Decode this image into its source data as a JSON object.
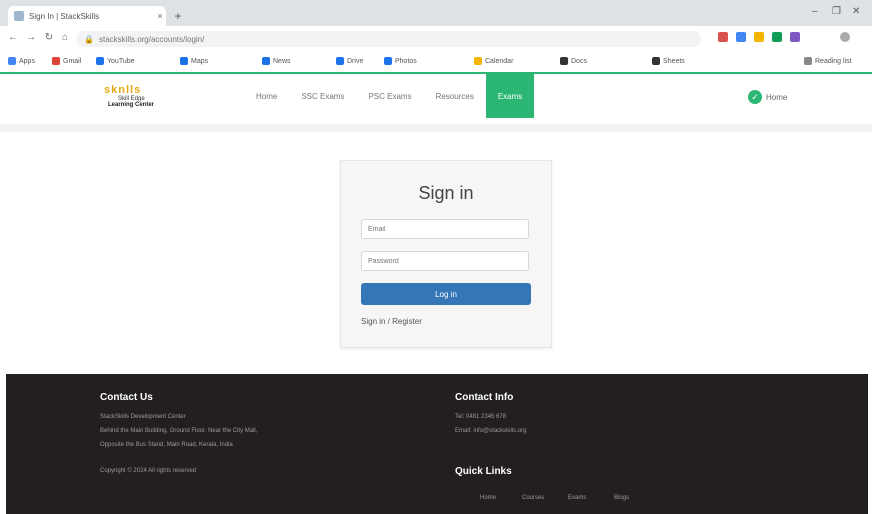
{
  "browser": {
    "tab_title": "Sign In | StackSkills",
    "tab_close": "×",
    "new_tab": "+",
    "url": "stackskills.org/accounts/login/",
    "bookmarks": [
      "Apps",
      "Gmail",
      "YouTube",
      "Maps",
      "News",
      "Drive",
      "Photos",
      "Calendar",
      "Docs",
      "Sheets"
    ],
    "other_bookmarks": "Reading list"
  },
  "site": {
    "logo_line1": "sknlls",
    "logo_line2": "Skill Edge",
    "logo_line3": "Learning Center",
    "nav": [
      "Home",
      "SSC Exams",
      "PSC Exams",
      "Resources",
      "Exams"
    ],
    "active_nav_index": 4,
    "user_initial": "✓",
    "user_label": "Home"
  },
  "signin": {
    "title": "Sign in",
    "email_placeholder": "Email",
    "password_placeholder": "Password",
    "login_label": "Log in",
    "signup_link": "Sign in / Register"
  },
  "footer": {
    "contact_us_title": "Contact Us",
    "contact_us_lines": [
      "StackSkills Development Center",
      "Behind the Main Building, Ground Floor, Near the City Mall,",
      "Opposite the Bus Stand, Main Road, Kerala, India",
      "Copyright © 2024 All rights reserved"
    ],
    "contact_info_title": "Contact Info",
    "contact_info_lines": [
      "Tel: 0481 2345 678",
      "Email: info@stackskills.org"
    ],
    "quick_links_title": "Quick Links",
    "quick_links": [
      "Home",
      "Courses",
      "Exams",
      "Blogs"
    ]
  },
  "colors": {
    "accent": "#2bb673",
    "login_button": "#3576b6",
    "footer_bg": "#231f20"
  }
}
